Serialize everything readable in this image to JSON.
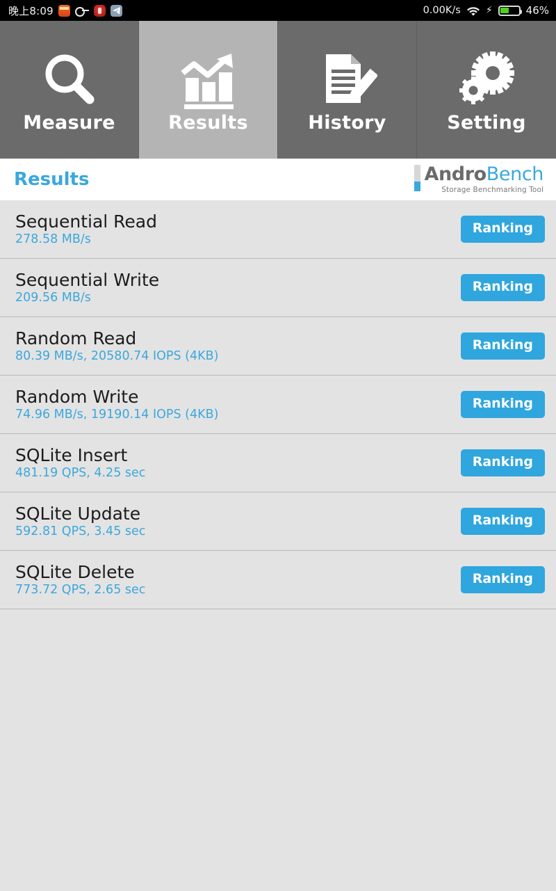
{
  "statusbar": {
    "clock": "晚上8:09",
    "left_icons": [
      "app-orange-icon",
      "key-icon",
      "app-red-icon",
      "telegram-plane-icon"
    ],
    "network_speed": "0.00K/s",
    "wifi_icon": "wifi-icon",
    "charging_icon": "charging-bolt-icon",
    "battery_percent": "46%",
    "battery_level": 46
  },
  "tabs": [
    {
      "label": "Measure",
      "icon": "magnifier-icon",
      "active": false
    },
    {
      "label": "Results",
      "icon": "bar-chart-trend-icon",
      "active": true
    },
    {
      "label": "History",
      "icon": "document-pencil-icon",
      "active": false
    },
    {
      "label": "Setting",
      "icon": "gears-icon",
      "active": false
    }
  ],
  "header": {
    "title": "Results",
    "brand_andro": "Andro",
    "brand_bench": "Bench",
    "brand_tagline": "Storage Benchmarking Tool"
  },
  "results": [
    {
      "title": "Sequential Read",
      "value": "278.58 MB/s",
      "button": "Ranking"
    },
    {
      "title": "Sequential Write",
      "value": "209.56 MB/s",
      "button": "Ranking"
    },
    {
      "title": "Random Read",
      "value": "80.39 MB/s, 20580.74 IOPS (4KB)",
      "button": "Ranking"
    },
    {
      "title": "Random Write",
      "value": "74.96 MB/s, 19190.14 IOPS (4KB)",
      "button": "Ranking"
    },
    {
      "title": "SQLite Insert",
      "value": "481.19 QPS, 4.25 sec",
      "button": "Ranking"
    },
    {
      "title": "SQLite Update",
      "value": "592.81 QPS, 3.45 sec",
      "button": "Ranking"
    },
    {
      "title": "SQLite Delete",
      "value": "773.72 QPS, 2.65 sec",
      "button": "Ranking"
    }
  ],
  "colors": {
    "accent_blue": "#3aa8dc",
    "button_blue": "#2fa6de",
    "tab_inactive": "#6b6b6b",
    "tab_active": "#b4b4b4",
    "list_bg": "#e4e3e3",
    "battery_green": "#4cd324"
  }
}
